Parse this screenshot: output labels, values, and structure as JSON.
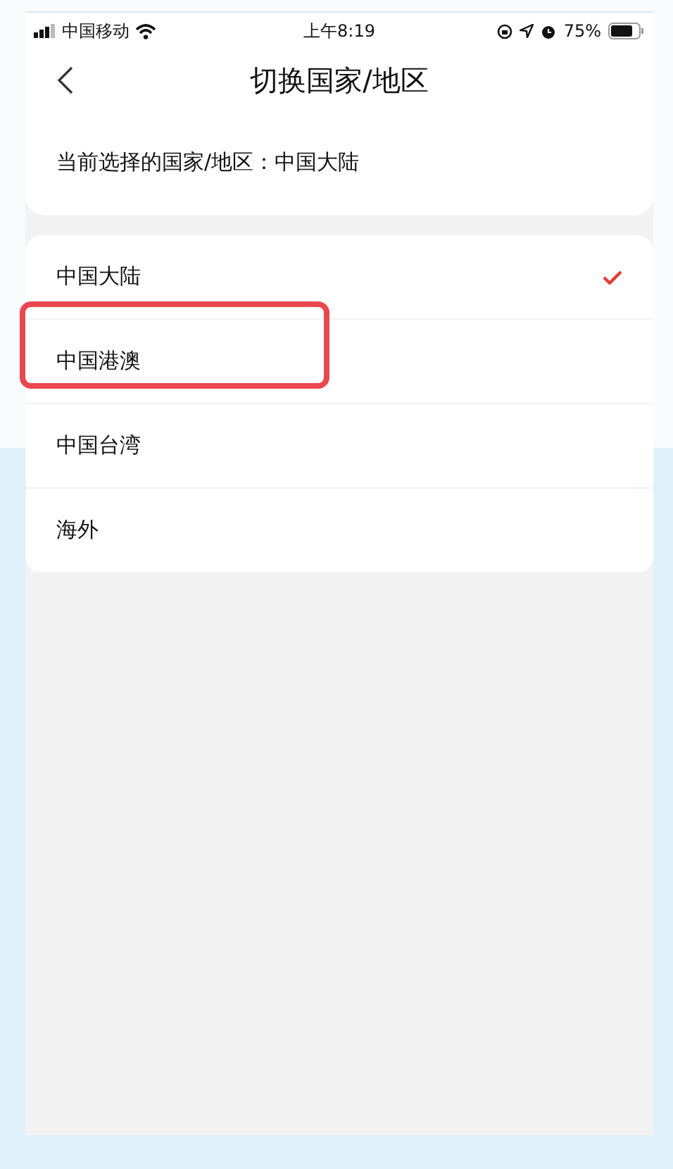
{
  "status_bar": {
    "carrier": "中国移动",
    "time": "上午8:19",
    "battery": "75%"
  },
  "nav": {
    "title": "切换国家/地区"
  },
  "current": {
    "text": "当前选择的国家/地区：中国大陆"
  },
  "regions": [
    {
      "label": "中国大陆",
      "selected": true,
      "highlighted": false
    },
    {
      "label": "中国港澳",
      "selected": false,
      "highlighted": true
    },
    {
      "label": "中国台湾",
      "selected": false,
      "highlighted": false
    },
    {
      "label": "海外",
      "selected": false,
      "highlighted": false
    }
  ]
}
